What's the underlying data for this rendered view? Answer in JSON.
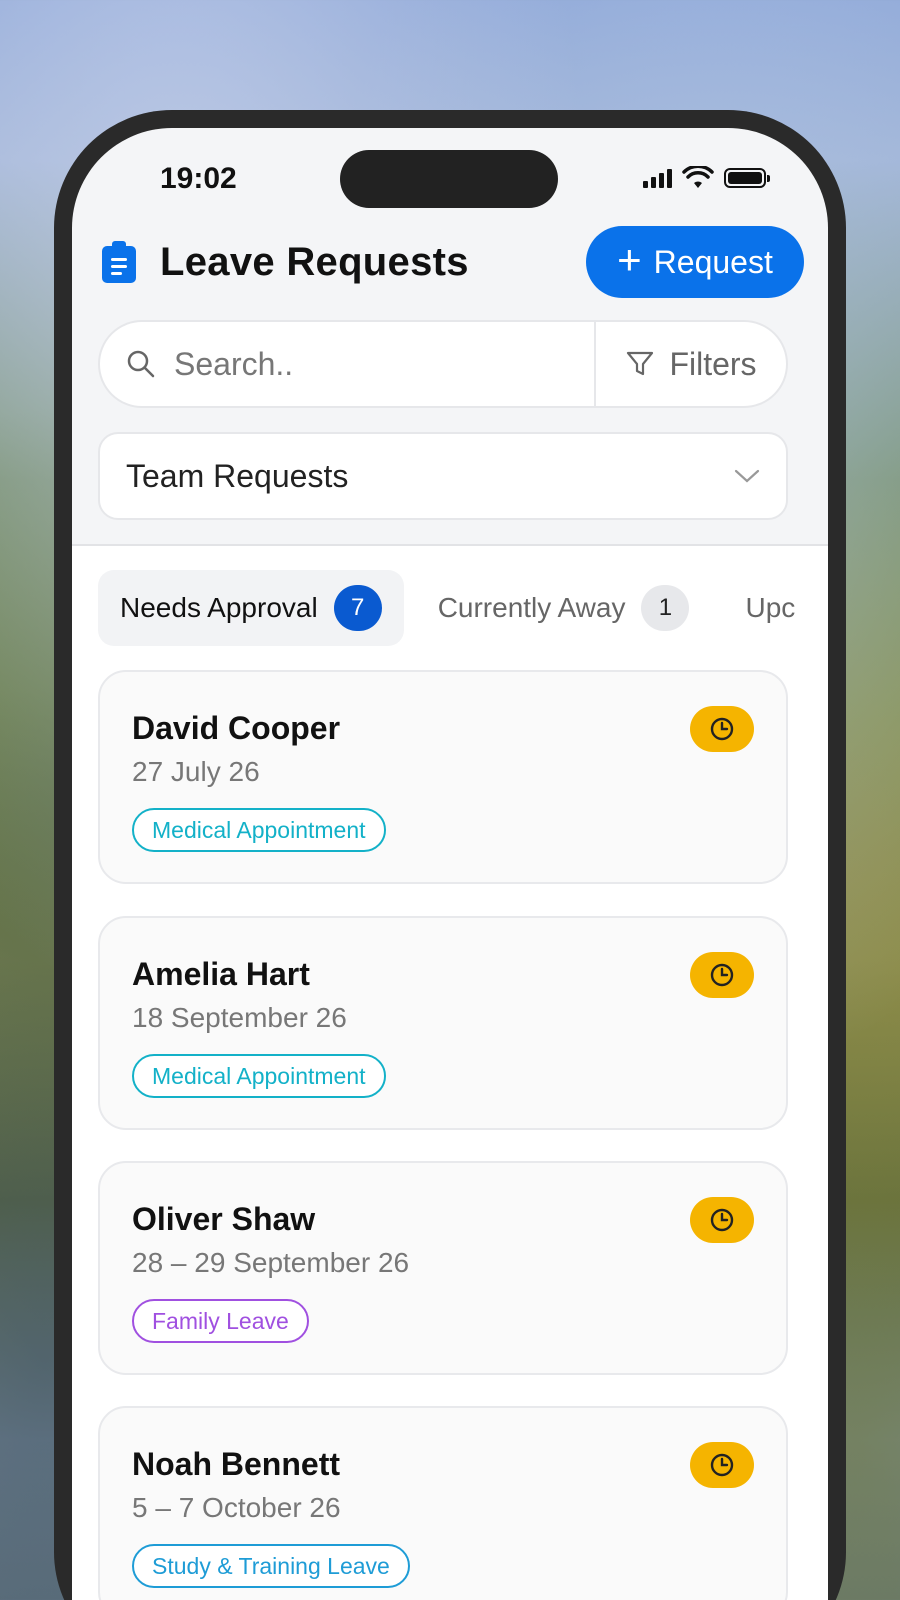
{
  "status_bar": {
    "time": "19:02"
  },
  "header": {
    "title": "Leave Requests",
    "request_label": "Request"
  },
  "search": {
    "placeholder": "Search..",
    "filters_label": "Filters"
  },
  "view_select": {
    "value": "Team Requests"
  },
  "tabs": [
    {
      "label": "Needs Approval",
      "count": "7"
    },
    {
      "label": "Currently Away",
      "count": "1"
    },
    {
      "label": "Upc"
    }
  ],
  "requests": [
    {
      "name": "David Cooper",
      "date": "27 July 26",
      "type": "Medical Appointment",
      "status_icon": "clock-icon"
    },
    {
      "name": "Amelia Hart",
      "date": "18 September 26",
      "type": "Medical Appointment",
      "status_icon": "clock-icon"
    },
    {
      "name": "Oliver Shaw",
      "date": "28 – 29 September 26",
      "type": "Family Leave",
      "status_icon": "clock-icon"
    },
    {
      "name": "Noah Bennett",
      "date": "5 – 7 October 26",
      "type": "Study & Training Leave",
      "status_icon": "clock-icon"
    }
  ],
  "colors": {
    "accent": "#0a72ea",
    "pending": "#f5b400",
    "medical": "#13b1c8",
    "family": "#a050e0"
  }
}
